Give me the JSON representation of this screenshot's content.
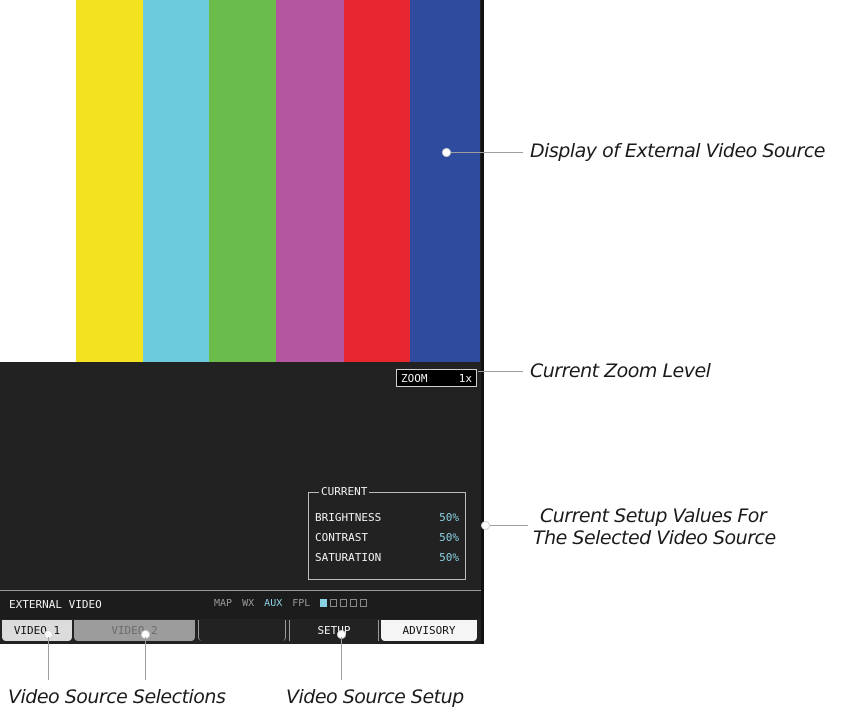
{
  "screen": {
    "color_bars": [
      "#ffffff",
      "#f2e21f",
      "#6ccbdc",
      "#6abd4b",
      "#b457a0",
      "#e8262f",
      "#2f4b9e"
    ],
    "zoom": {
      "label": "ZOOM",
      "value": "1x"
    },
    "current": {
      "title": "CURRENT",
      "rows": [
        {
          "label": "BRIGHTNESS",
          "value": "50%"
        },
        {
          "label": "CONTRAST",
          "value": "50%"
        },
        {
          "label": "SATURATION",
          "value": "50%"
        }
      ]
    },
    "status": {
      "page_name": "EXTERNAL VIDEO",
      "page_groups": [
        "MAP",
        "WX",
        "AUX",
        "FPL"
      ],
      "active_group": "AUX",
      "page_boxes": 5,
      "active_box": 1
    },
    "softkeys": [
      {
        "label": "VIDEO 1",
        "state": "normal"
      },
      {
        "label": "VIDEO 2",
        "state": "disabled"
      },
      {
        "label": "",
        "state": "empty"
      },
      {
        "label": "SETUP",
        "state": "normal"
      },
      {
        "label": "ADVISORY",
        "state": "highlight"
      }
    ]
  },
  "callouts": {
    "video_source": "Display of External Video Source",
    "zoom_level": "Current Zoom Level",
    "setup_values_line1": "Current Setup Values For",
    "setup_values_line2": "The Selected Video Source",
    "source_selections": "Video Source Selections",
    "source_setup": "Video Source Setup"
  }
}
